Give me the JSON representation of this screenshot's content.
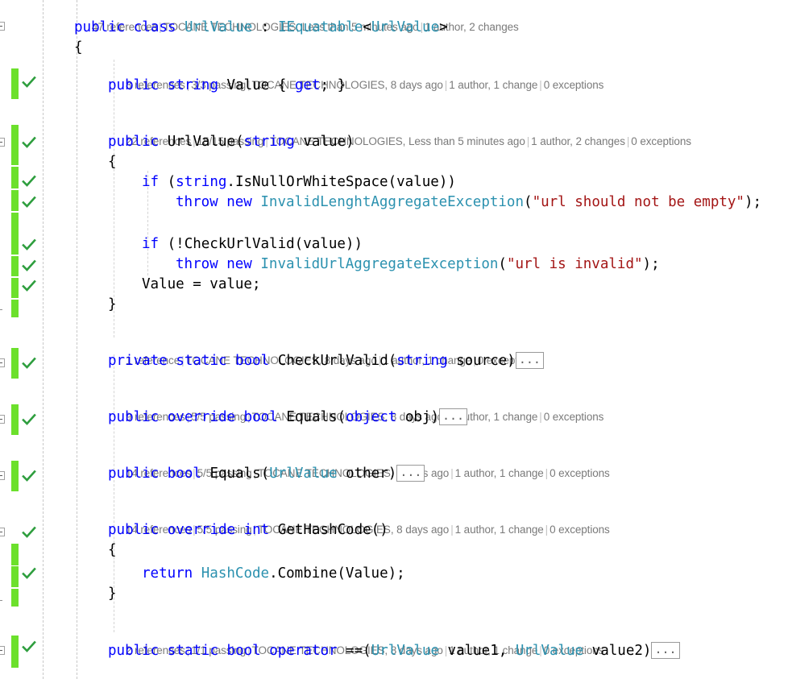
{
  "editor": {
    "language": "csharp",
    "colors": {
      "keyword": "#0000FF",
      "type": "#2B91AF",
      "string": "#A31515",
      "plain": "#000000",
      "codelens_text": "#7A7A7A",
      "coverage_bar": "#6CE02C",
      "test_pass_check": "#2E9E3E",
      "guide_line": "#C8C8C8",
      "background": "#FFFFFF"
    },
    "collapsed_marker": "..."
  },
  "codelens": [
    {
      "id": "class-urlvalue",
      "references": "47 references",
      "tests": null,
      "author_info": "TOCANE TECHNOLOGIES, Less than 5 minutes ago",
      "changes": "1 author, 2 changes",
      "exceptions": null
    },
    {
      "id": "prop-value",
      "references": "8 references",
      "tests": "3/3 passing",
      "author_info": "TOCANE TECHNOLOGIES, 8 days ago",
      "changes": "1 author, 1 change",
      "exceptions": "0 exceptions"
    },
    {
      "id": "ctor-urlvalue",
      "references": "22 references",
      "tests": "15/15 passing",
      "author_info": "TOCANE TECHNOLOGIES, Less than 5 minutes ago",
      "changes": "1 author, 2 changes",
      "exceptions": "0 exceptions"
    },
    {
      "id": "method-checkurlvalid",
      "references": "1 reference",
      "tests": null,
      "author_info": "TOCANE TECHNOLOGIES, 8 days ago",
      "changes": "1 author, 1 change",
      "exceptions": "0 exceptions"
    },
    {
      "id": "method-equals-object",
      "references": "9 references",
      "tests": "5/5 passing",
      "author_info": "TOCANE TECHNOLOGIES, 8 days ago",
      "changes": "1 author, 1 change",
      "exceptions": "0 exceptions"
    },
    {
      "id": "method-equals-urlvalue",
      "references": "14 references",
      "tests": "5/5 passing",
      "author_info": "TOCANE TECHNOLOGIES, 8 days ago",
      "changes": "1 author, 1 change",
      "exceptions": "0 exceptions"
    },
    {
      "id": "method-gethashcode",
      "references": "14 references",
      "tests": "5/5 passing",
      "author_info": "TOCANE TECHNOLOGIES, 8 days ago",
      "changes": "1 author, 1 change",
      "exceptions": "0 exceptions"
    },
    {
      "id": "operator-equality",
      "references": "2 references",
      "tests": "1/1 passing",
      "author_info": "TOCANE TECHNOLOGIES, 8 days ago",
      "changes": "1 author, 1 change",
      "exceptions": "0 exceptions"
    }
  ],
  "code_lines": {
    "class_decl": "public class UrlValue : IEquatable<UrlValue>",
    "class_open": "{",
    "prop_value": "public string Value { get; }",
    "ctor_sig": "public UrlValue(string value)",
    "ctor_open": "{",
    "if_null": "if (string.IsNullOrWhiteSpace(value))",
    "throw_length": "throw new InvalidLenghtAggregateException(\"url should not be empty\");",
    "if_invalid": "if (!CheckUrlValid(value))",
    "throw_invalid": "throw new InvalidUrlAggregateException(\"url is invalid\");",
    "assign_value": "Value = value;",
    "ctor_close": "}",
    "checkurlvalid_sig": "private static bool CheckUrlValid(string source)",
    "equals_object_sig": "public override bool Equals(object obj)",
    "equals_urlvalue_sig": "public bool Equals(UrlValue other)",
    "gethashcode_sig": "public override int GetHashCode()",
    "gethashcode_open": "{",
    "gethashcode_body": "return HashCode.Combine(Value);",
    "gethashcode_close": "}",
    "operator_eq_sig": "public static bool operator ==(UrlValue value1, UrlValue value2)"
  },
  "tokens": {
    "kw_public": "public",
    "kw_class": "class",
    "kw_string": "string",
    "kw_private": "private",
    "kw_static": "static",
    "kw_bool": "bool",
    "kw_override": "override",
    "kw_int": "int",
    "kw_object": "object",
    "kw_if": "if",
    "kw_throw": "throw",
    "kw_new": "new",
    "kw_return": "return",
    "kw_get": "get",
    "kw_operator": "operator",
    "type_UrlValue": "UrlValue",
    "type_IEquatable": "IEquatable",
    "type_InvalidLenghtAggregateException": "InvalidLenghtAggregateException",
    "type_InvalidUrlAggregateException": "InvalidUrlAggregateException",
    "type_HashCode": "HashCode",
    "str_empty_msg": "\"url should not be empty\"",
    "str_invalid_msg": "\"url is invalid\"",
    "id_Value": "Value",
    "id_value": "value",
    "id_IsNullOrWhiteSpace": "IsNullOrWhiteSpace",
    "id_CheckUrlValid": "CheckUrlValid",
    "id_Equals": "Equals",
    "id_obj": "obj",
    "id_other": "other",
    "id_GetHashCode": "GetHashCode",
    "id_Combine": "Combine",
    "id_source": "source",
    "id_value1": "value1",
    "id_value2": "value2"
  },
  "gutter": {
    "test_status_icon": "checkmark-pass-icon",
    "coverage_indicator": "changed-lines-bar",
    "outline_toggle": "collapse-expand-box"
  }
}
